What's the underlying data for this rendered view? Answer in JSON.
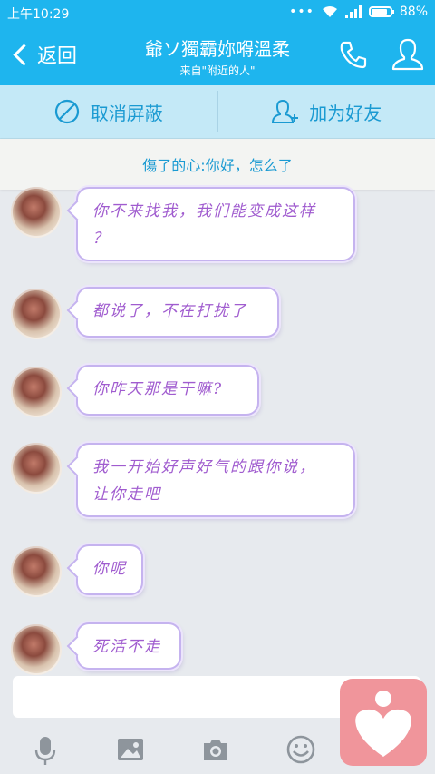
{
  "status": {
    "time": "上午10:29",
    "dots": "•••",
    "battery_pct": "88%",
    "battery_level": 0.88
  },
  "header": {
    "back_label": "返回",
    "title": "爺ソ獨霸妳嘚溫柔",
    "subtitle": "来自\"附近的人\""
  },
  "actions": {
    "unblock_label": "取消屏蔽",
    "add_friend_label": "加为好友"
  },
  "notice": {
    "text": "傷了的心:你好，怎么了"
  },
  "messages": [
    {
      "line1": "你不来找我，我们能变成这样",
      "line2": "？"
    },
    {
      "line1": "都说了，不在打扰了",
      "line2": ""
    },
    {
      "line1": "你昨天那是干嘛?",
      "line2": ""
    },
    {
      "line1": "我一开始好声好气的跟你说，",
      "line2": "让你走吧"
    },
    {
      "line1": "你呢",
      "line2": ""
    },
    {
      "line1": "死活不走",
      "line2": ""
    }
  ],
  "input": {
    "value": "",
    "placeholder": ""
  },
  "colors": {
    "accent": "#1eb5ee",
    "action_text": "#1a9ad2",
    "bubble_text": "#a05ccf",
    "bubble_border": "#c5b3ef",
    "heart_bg": "#f0959b"
  },
  "icons": [
    "mic-icon",
    "image-icon",
    "camera-icon",
    "emoji-icon",
    "heart-icon",
    "phone-icon",
    "profile-icon",
    "block-icon",
    "add-friend-icon"
  ]
}
